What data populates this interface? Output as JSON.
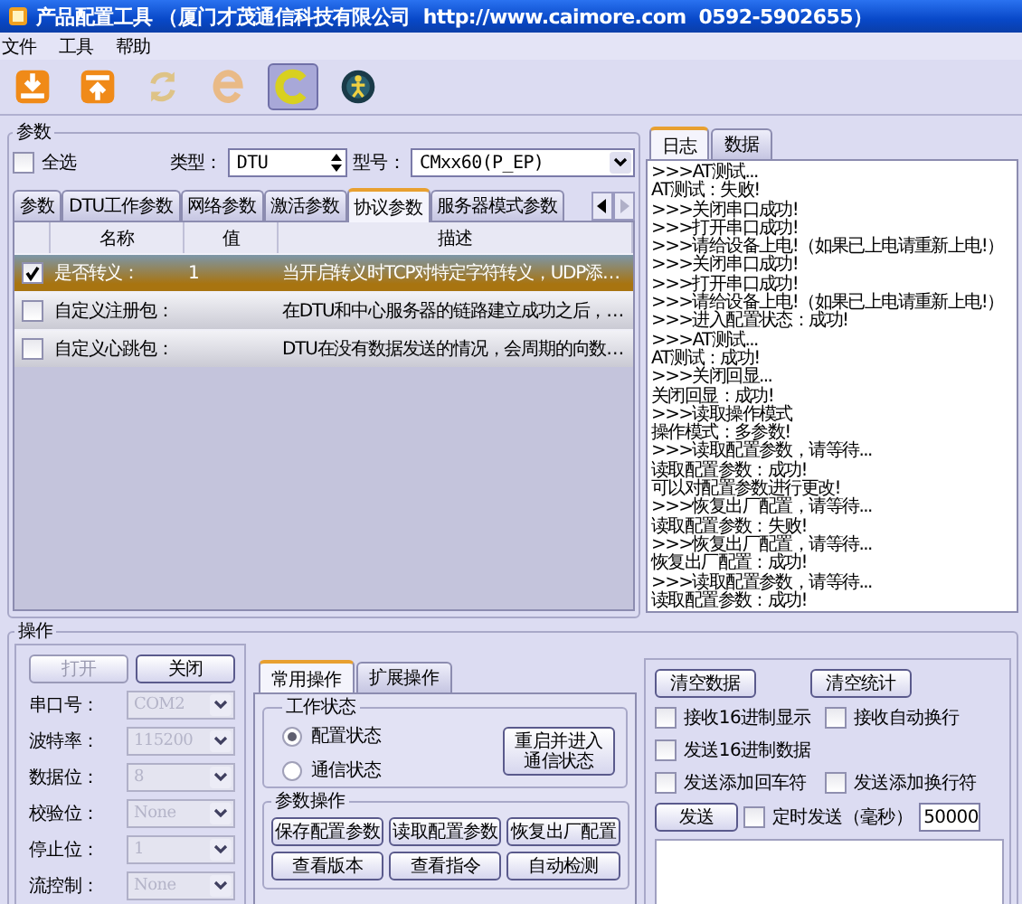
{
  "window": {
    "title": "产品配置工具 （厦门才茂通信科技有限公司  http://www.caimore.com  0592-5902655）"
  },
  "menu": [
    "文件",
    "工具",
    "帮助"
  ],
  "toolbar": [
    {
      "kind": "download",
      "disabled": false,
      "selected": false
    },
    {
      "kind": "upload",
      "disabled": false,
      "selected": false
    },
    {
      "kind": "refresh",
      "disabled": true,
      "selected": false
    },
    {
      "kind": "e",
      "disabled": true,
      "selected": false
    },
    {
      "kind": "c",
      "disabled": false,
      "selected": true
    },
    {
      "kind": "run",
      "disabled": false,
      "selected": false
    }
  ],
  "params": {
    "title": "参数",
    "select_all": {
      "label": "全选",
      "checked": false
    },
    "type_label": "类型：",
    "type_value": "DTU",
    "model_label": "型号：",
    "model_value": "CMxx60(P_EP)",
    "tabs": [
      {
        "label": "参数",
        "selected": false
      },
      {
        "label": "DTU工作参数",
        "selected": false
      },
      {
        "label": "网络参数",
        "selected": false
      },
      {
        "label": "激活参数",
        "selected": false
      },
      {
        "label": "协议参数",
        "selected": true
      },
      {
        "label": "服务器模式参数",
        "selected": false
      }
    ],
    "columns": [
      "名称",
      "值",
      "描述"
    ],
    "rows": [
      {
        "checked": true,
        "selected": true,
        "name": "是否转义：",
        "value": "1",
        "description": "当开启转义时TCP对特定字符转义，UDP添…"
      },
      {
        "checked": false,
        "selected": false,
        "name": "自定义注册包：",
        "value": "",
        "description": "在DTU和中心服务器的链路建立成功之后，…"
      },
      {
        "checked": false,
        "selected": false,
        "name": "自定义心跳包：",
        "value": "",
        "description": "DTU在没有数据发送的情况，会周期的向数…"
      }
    ]
  },
  "log": {
    "tabs": [
      {
        "label": "日志",
        "selected": true
      },
      {
        "label": "数据",
        "selected": false
      }
    ],
    "lines": [
      ">>>AT测试...",
      "AT测试：失败!",
      ">>>关闭串口成功!",
      ">>>打开串口成功!",
      ">>>请给设备上电!（如果已上电请重新上电!）",
      ">>>关闭串口成功!",
      ">>>打开串口成功!",
      ">>>请给设备上电!（如果已上电请重新上电!）",
      ">>>进入配置状态：成功!",
      ">>>AT测试...",
      "AT测试：成功!",
      ">>>关闭回显...",
      "关闭回显：成功!",
      ">>>读取操作模式",
      "操作模式：多参数!",
      ">>>读取配置参数，请等待...",
      "读取配置参数：成功!",
      "可以对配置参数进行更改!",
      ">>>恢复出厂配置，请等待...",
      "读取配置参数：失败!",
      ">>>恢复出厂配置，请等待...",
      "恢复出厂配置：成功!",
      ">>>读取配置参数，请等待...",
      "读取配置参数：成功!"
    ]
  },
  "operations": {
    "title": "操作",
    "open_button": {
      "label": "打开",
      "disabled": true
    },
    "close_button": {
      "label": "关闭",
      "disabled": false
    },
    "serial_fields": [
      {
        "label": "串口号：",
        "value": "COM2",
        "disabled": true
      },
      {
        "label": "波特率：",
        "value": "115200",
        "disabled": true
      },
      {
        "label": "数据位：",
        "value": "8",
        "disabled": true
      },
      {
        "label": "校验位：",
        "value": "None",
        "disabled": true
      },
      {
        "label": "停止位：",
        "value": "1",
        "disabled": true
      },
      {
        "label": "流控制：",
        "value": "None",
        "disabled": true
      }
    ],
    "tabs": [
      {
        "label": "常用操作",
        "selected": true
      },
      {
        "label": "扩展操作",
        "selected": false
      }
    ],
    "work_state": {
      "title": "工作状态",
      "options": [
        {
          "label": "配置状态",
          "selected": true
        },
        {
          "label": "通信状态",
          "selected": false
        }
      ],
      "restart_button": "重启并进入通信状态"
    },
    "param_ops": {
      "title": "参数操作",
      "buttons": [
        "保存配置参数",
        "读取配置参数",
        "恢复出厂配置",
        "查看版本",
        "查看指令",
        "自动检测"
      ]
    }
  },
  "comm": {
    "buttons": [
      "清空数据",
      "清空统计"
    ],
    "options": [
      {
        "label": "接收16进制显示",
        "checked": false
      },
      {
        "label": "接收自动换行",
        "checked": false
      },
      {
        "label": "发送16进制数据",
        "checked": false
      }
    ],
    "options2": [
      {
        "label": "发送添加回车符",
        "checked": false
      },
      {
        "label": "发送添加换行符",
        "checked": false
      }
    ],
    "send_button": "发送",
    "timed": {
      "label": "定时发送（毫秒）",
      "checked": false
    },
    "interval": "50000"
  }
}
